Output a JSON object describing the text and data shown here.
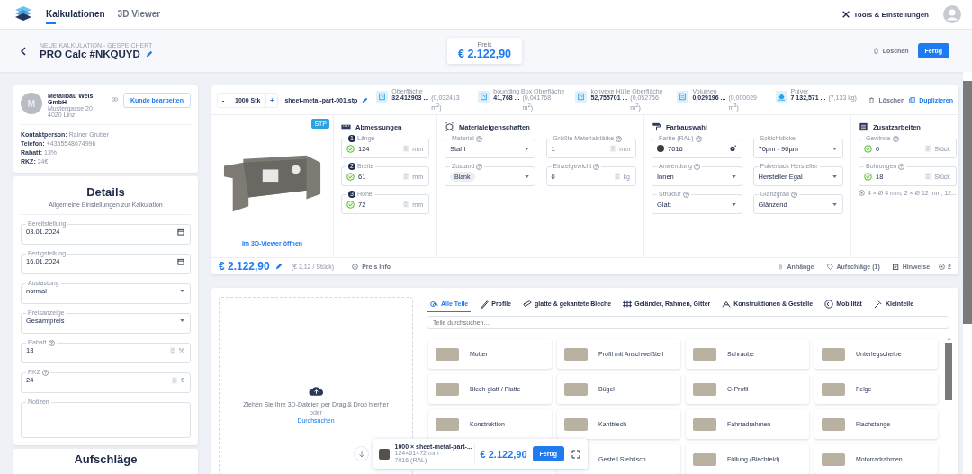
{
  "nav": {
    "tabs": [
      {
        "label": "Kalkulationen",
        "selected": true
      },
      {
        "label": "3D Viewer",
        "selected": false
      }
    ],
    "tools": "Tools & Einstellungen"
  },
  "header": {
    "subtitle": "NEUE KALKULATION - GESPEICHERT",
    "title": "PRO Calc #NKQUYD",
    "price_label": "Preis",
    "price": "€ 2.122,90",
    "delete": "Löschen",
    "done": "Fertig"
  },
  "customer": {
    "avatar": "M",
    "name": "Metallbau Weis GmbH",
    "street": "Mustergasse 20",
    "city": "4020 Linz",
    "edit": "Kunde bearbeiten",
    "info": [
      "**Kontaktperson:** Rainer Gruber",
      "**Telefon:** +4355548674996",
      "**Rabatt:** 13%",
      "**RKZ:** 24€"
    ]
  },
  "details": {
    "title": "Details",
    "subtitle": "Allgemeine Einstellungen zur Kalkulation",
    "fields": [
      {
        "kind": "date",
        "label": "Bereitstellung",
        "help": false,
        "value": "03.01.2024"
      },
      {
        "kind": "date",
        "label": "Fertigstellung",
        "help": false,
        "value": "16.01.2024"
      },
      {
        "kind": "select",
        "label": "Auslastung",
        "help": false,
        "value": "normal"
      },
      {
        "kind": "select",
        "label": "Preisanzeige",
        "help": false,
        "value": "Gesamtpreis"
      },
      {
        "kind": "number",
        "label": "Rabatt",
        "help": true,
        "value": "13",
        "unit": "%"
      },
      {
        "kind": "number",
        "label": "RKZ",
        "help": true,
        "value": "24",
        "unit": "€"
      },
      {
        "kind": "textarea",
        "label": "Notizen",
        "help": false
      }
    ]
  },
  "surcharges": {
    "title": "Aufschläge"
  },
  "part": {
    "minus": "-",
    "quantity": "1000 Stk",
    "plus": "+",
    "file": "sheet-metal-part-001.stp",
    "metrics": [
      {
        "kind": "area",
        "label": "Oberfläche",
        "value": "32,412903 ...",
        "converted": "(0,032413 m$^{2}$)"
      },
      {
        "kind": "area",
        "label": "bounding Box Oberfläche",
        "value": "41,768 ...",
        "converted": "(0,041768 m$^{2}$)"
      },
      {
        "kind": "area",
        "label": "konvexe Hülle Oberfläche",
        "value": "52,755701 ...",
        "converted": "(0,052756 m$^{2}$)"
      },
      {
        "kind": "volume",
        "label": "Volumen",
        "value": "0,029196 ...",
        "converted": "(0,000029 m$^{3}$)"
      },
      {
        "kind": "powder",
        "label": "Pulver",
        "value": "7 132,571 ...",
        "converted": "(7,133 kg)"
      }
    ],
    "delete": "Löschen",
    "duplicate": "Duplizieren",
    "format": "STP",
    "open_viewer": "Im 3D-Viewer öffnen",
    "sections": [
      {
        "kind": "dimensions",
        "title": "Abmessungen",
        "fields": [
          {
            "kind": "number",
            "label": "Länge",
            "badge": "1",
            "help": false,
            "valid": true,
            "value": "124",
            "unit": "mm"
          },
          {
            "kind": "number",
            "label": "Breite",
            "badge": "2",
            "help": false,
            "valid": true,
            "value": "61",
            "unit": "mm"
          },
          {
            "kind": "number",
            "label": "Höhe",
            "badge": "3",
            "help": false,
            "valid": true,
            "value": "72",
            "unit": "mm"
          }
        ]
      },
      {
        "kind": "material",
        "title": "Materialeigenschaften",
        "fields": [
          {
            "kind": "select",
            "label": "Material",
            "help": true,
            "valid": false,
            "value": "Stahl"
          },
          {
            "kind": "number",
            "label": "Größte Materialstärke",
            "help": true,
            "valid": false,
            "value": "1",
            "unit": "mm"
          },
          {
            "kind": "chip",
            "label": "Zustand",
            "help": true,
            "valid": false,
            "value": "Blank"
          },
          {
            "kind": "number",
            "label": "Einzelgewicht",
            "help": true,
            "valid": false,
            "value": "0",
            "unit": "kg"
          }
        ]
      },
      {
        "kind": "color",
        "title": "Farbauswahl",
        "fields": [
          {
            "kind": "color",
            "label": "Farbe (RAL)",
            "help": true,
            "valid": false,
            "value": "7016",
            "color": "#383e42"
          },
          {
            "kind": "select",
            "label": "Schichtdicke",
            "help": false,
            "valid": false,
            "value": "70µm - 90µm"
          },
          {
            "kind": "select",
            "label": "Anwendung",
            "help": true,
            "valid": false,
            "value": "Innen"
          },
          {
            "kind": "select",
            "label": "Pulverlack Hersteller",
            "help": false,
            "valid": false,
            "value": "Hersteller Egal"
          },
          {
            "kind": "select",
            "label": "Struktur",
            "help": true,
            "valid": false,
            "value": "Glatt"
          },
          {
            "kind": "select",
            "label": "Glanzgrad",
            "help": true,
            "valid": false,
            "value": "Glänzend"
          }
        ]
      },
      {
        "kind": "extras",
        "title": "Zusatzarbeiten",
        "fields": [
          {
            "kind": "number",
            "label": "Gewinde",
            "help": true,
            "valid": true,
            "value": "0",
            "unit": "Stück"
          },
          {
            "kind": "number",
            "label": "Bohrungen",
            "help": true,
            "valid": true,
            "value": "18",
            "unit": "Stück"
          }
        ],
        "note": "4 × Ø 4 mm, 2 × Ø 12 mm, 12..."
      }
    ],
    "price": "€ 2.122,90",
    "unit_price": "(€ 2,12 / Stück)",
    "price_info": "Preis Info",
    "attachments": "Anhänge",
    "surcharges": "Aufschläge (1)",
    "notes": "Hinweise",
    "notes_count": "2"
  },
  "catalog": {
    "dropzone": {
      "text": "Ziehen Sie Ihre 3D-Dateien per Drag & Drop hierher",
      "or": "oder",
      "browse": "Durchsuchen"
    },
    "tabs": [
      {
        "label": "Alle Teile",
        "selected": true
      },
      {
        "label": "Profile",
        "selected": false
      },
      {
        "label": "glatte & gekantete Bleche",
        "selected": false
      },
      {
        "label": "Geländer, Rahmen, Gitter",
        "selected": false
      },
      {
        "label": "Konstruktionen & Gestelle",
        "selected": false
      },
      {
        "label": "Mobilität",
        "selected": false
      },
      {
        "label": "Kleinteile",
        "selected": false
      }
    ],
    "search_placeholder": "Teile durchsuchen...",
    "items": [
      "Mutter",
      "Profil mit Anschweißteil",
      "Schraube",
      "Unterlegscheibe",
      "Blech glatt / Platte",
      "Bügel",
      "C-Profil",
      "Felge",
      "Konstruktion",
      "Kantblech",
      "Fahrradrahmen",
      "Flachstange",
      "Gestell Stehtisch",
      "Füllung (Blechfeld)",
      "Motorradrahmen"
    ]
  },
  "float_bar": {
    "title": "1000 × sheet-metal-part-...",
    "dims": "124×61×72 mm",
    "ral": "7016 (RAL)",
    "price": "€ 2.122,90",
    "done": "Fertig"
  }
}
